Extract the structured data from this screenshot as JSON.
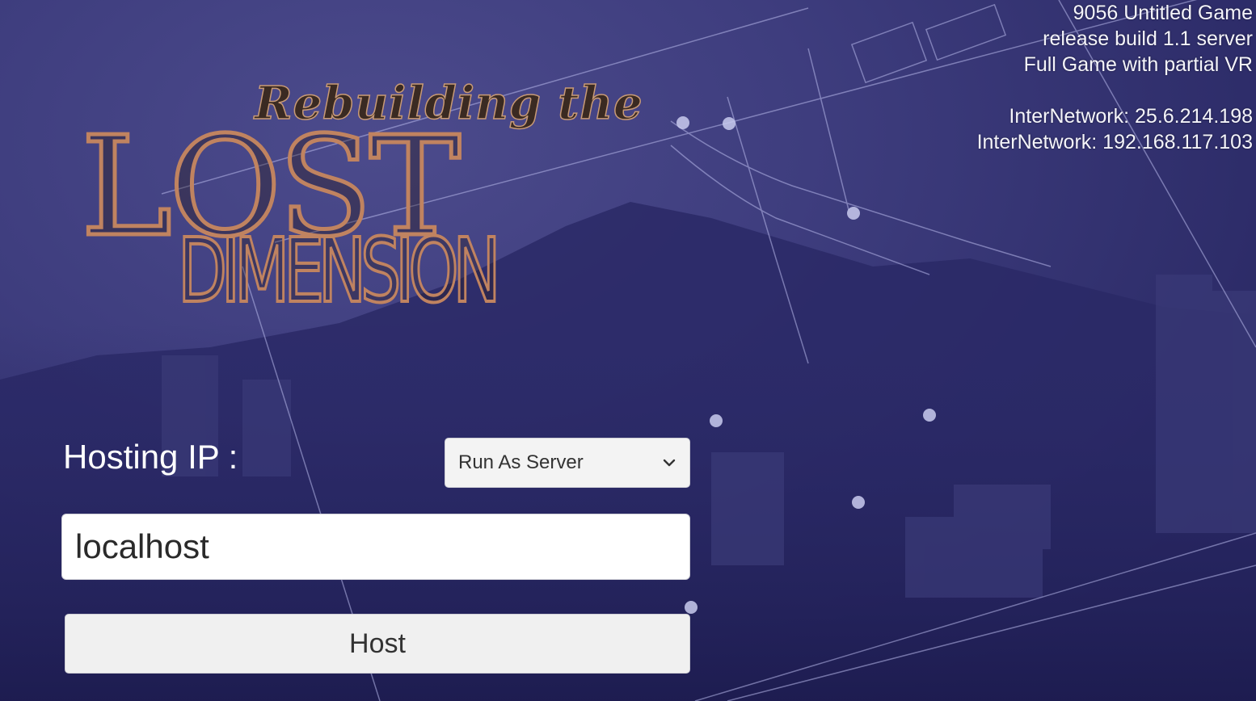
{
  "build_info": {
    "game_title": "9056 Untitled Game",
    "build": "release build 1.1 server",
    "edition": "Full Game with partial VR",
    "network_1": "InterNetwork: 25.6.214.198",
    "network_2": "InterNetwork: 192.168.117.103"
  },
  "logo": {
    "line_1": "Rebuilding the",
    "line_2": "LOST",
    "line_3": "DIMENSION"
  },
  "form": {
    "hosting_label": "Hosting IP :",
    "mode_select": {
      "selected": "Run As Server"
    },
    "ip_input": {
      "value": "localhost"
    },
    "host_button_label": "Host"
  },
  "colors": {
    "background": "#3e3d7e",
    "logo_copper": "#c08360",
    "text_light": "#f4f4fa"
  },
  "icons": {
    "dropdown": "chevron-down-icon"
  }
}
